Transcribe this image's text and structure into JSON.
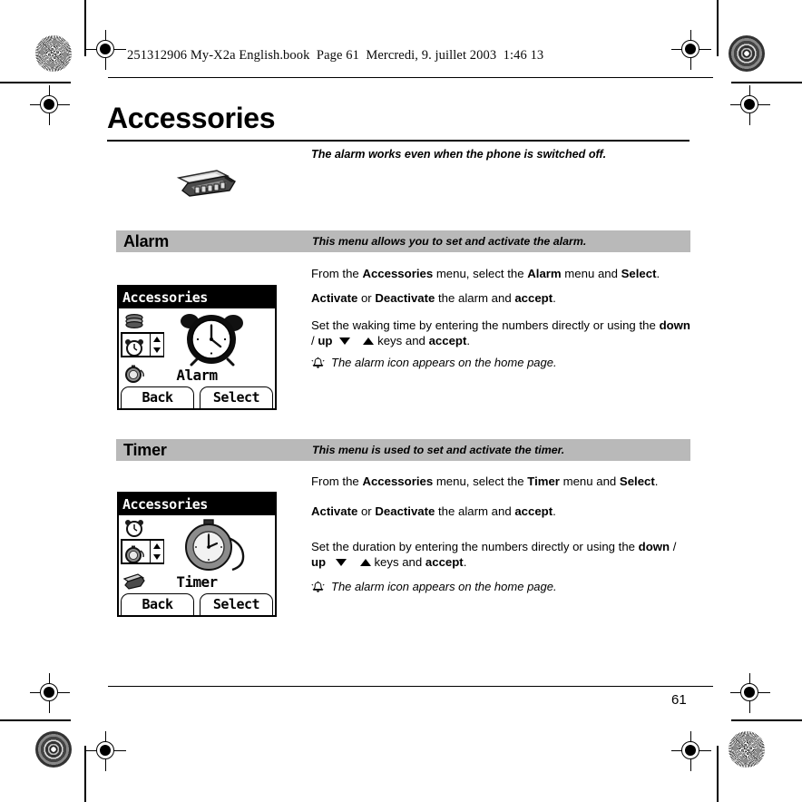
{
  "document": {
    "header_note": "251312906 My-X2a English.book  Page 61  Mercredi, 9. juillet 2003  1:46 13",
    "chapter_title": "Accessories",
    "intro_note": "The alarm works even when the phone  is switched off.",
    "page_number": "61",
    "accessories_icon": "toolbox-icon"
  },
  "colors": {
    "section_band": "#b9b9b9",
    "text": "#000000",
    "page_background": "#ffffff"
  },
  "sections": [
    {
      "id": "alarm",
      "title": "Alarm",
      "subtitle": "This menu allows you to set and activate the alarm.",
      "paragraphs": {
        "p1": {
          "part1": "From the ",
          "bold1": "Accessories",
          "part2": " menu, select the ",
          "bold2": "Alarm",
          "part3": " menu and ",
          "bold3": "Select",
          "part4": "."
        },
        "p2": {
          "bold1": "Activate",
          "part1": " or ",
          "bold2": "Deactivate",
          "part2": " the alarm and ",
          "bold3": "accept",
          "part3": "."
        },
        "p3": {
          "part1": "Set the waking time by entering the numbers directly or using the ",
          "bold1": "down",
          "part2": " / ",
          "bold2": "up",
          "down_key_icon": "triangle-down-icon",
          "up_key_icon": "triangle-up-icon",
          "part3": " keys and ",
          "bold3": "accept",
          "part4": "."
        },
        "note": {
          "icon": "bell-icon",
          "text": "The alarm icon appears on the home page."
        }
      },
      "screenshot": {
        "title": "Accessories",
        "item_label": "Alarm",
        "artwork": "alarm-clock-icon",
        "list_icons": [
          "stack-icon",
          "alarm-clock-icon",
          "stopwatch-icon"
        ],
        "scroll_up_icon": "scroll-up-icon",
        "scroll_down_icon": "scroll-down-icon",
        "softkey_left": "Back",
        "softkey_right": "Select"
      }
    },
    {
      "id": "timer",
      "title": "Timer",
      "subtitle": "This menu is used to set and activate the timer.",
      "paragraphs": {
        "p1": {
          "part1": "From the ",
          "bold1": "Accessories",
          "part2": " menu, select the ",
          "bold2": "Timer",
          "part3": " menu and ",
          "bold3": "Select",
          "part4": "."
        },
        "p2": {
          "bold1": "Activate",
          "part1": " or ",
          "bold2": "Deactivate",
          "part2": " the alarm and ",
          "bold3": "accept",
          "part3": "."
        },
        "p3": {
          "part1": "Set the duration by entering the numbers directly or using the ",
          "bold1": "down",
          "part2": " / ",
          "bold2": "up",
          "down_key_icon": "triangle-down-icon",
          "up_key_icon": "triangle-up-icon",
          "part3": " keys and ",
          "bold3": "accept",
          "part4": "."
        },
        "note": {
          "icon": "bell-icon",
          "text": "The alarm icon appears on the home page."
        }
      },
      "screenshot": {
        "title": "Accessories",
        "item_label": "Timer",
        "artwork": "stopwatch-icon",
        "list_icons": [
          "alarm-clock-icon",
          "stopwatch-icon",
          "toolbox-icon"
        ],
        "scroll_up_icon": "scroll-up-icon",
        "scroll_down_icon": "scroll-down-icon",
        "softkey_left": "Back",
        "softkey_right": "Select"
      }
    }
  ],
  "print_marks": {
    "registration_marks": 8,
    "rosettes": 4,
    "description": "prepress registration crosshairs and colour rosettes"
  }
}
